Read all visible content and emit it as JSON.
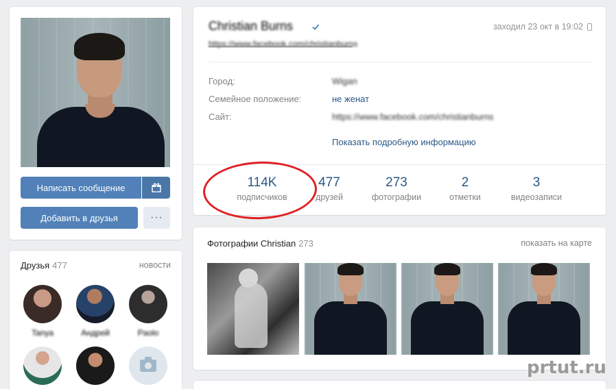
{
  "profile": {
    "name": "Christian Burns",
    "status_link": "https://www.facebook.com/christianburns",
    "last_seen": "заходил 23 окт в 19:02",
    "info": [
      {
        "label": "Город:",
        "value": "Wigan"
      },
      {
        "label": "Семейное положение:",
        "value": "не женат"
      },
      {
        "label": "Сайт:",
        "value": "https://www.facebook.com/christianburns"
      }
    ],
    "show_more": "Показать подробную информацию",
    "counters": [
      {
        "num": "114K",
        "label": "подписчиков"
      },
      {
        "num": "477",
        "label": "друзей"
      },
      {
        "num": "273",
        "label": "фотографии"
      },
      {
        "num": "2",
        "label": "отметки"
      },
      {
        "num": "3",
        "label": "видеозаписи"
      }
    ]
  },
  "actions": {
    "write_message": "Написать сообщение",
    "add_friend": "Добавить в друзья",
    "more": "···"
  },
  "friends": {
    "title": "Друзья",
    "count": "477",
    "news": "новости",
    "names": [
      "Tanya",
      "Андрей",
      "Paolo",
      "",
      "",
      ""
    ]
  },
  "photos": {
    "title": "Фотографии Christian",
    "count": "273",
    "map_link": "показать на карте"
  },
  "watermark": "prtut.ru",
  "colors": {
    "accent": "#5181b8",
    "link": "#2a5885",
    "highlight": "#e02025",
    "background": "#edeef0"
  }
}
